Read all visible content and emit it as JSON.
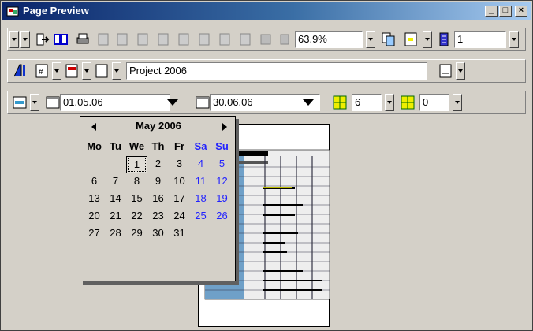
{
  "window": {
    "title": "Page Preview",
    "minimize": "_",
    "maximize": "□",
    "close": "×"
  },
  "toolbar1": {
    "zoom_value": "63.9%",
    "pages_value": "1"
  },
  "toolbar2": {
    "project_name": "Project 2006"
  },
  "toolbar3": {
    "start_date": "01.05.06",
    "end_date": "30.06.06",
    "rows_value": "6",
    "cols_value": "0"
  },
  "calendar": {
    "month_label": "May 2006",
    "weekdays": [
      "Mo",
      "Tu",
      "We",
      "Th",
      "Fr",
      "Sa",
      "Su"
    ],
    "weeks": [
      [
        "",
        "",
        "",
        "1",
        "2",
        "3",
        "4",
        "5"
      ],
      [
        "6",
        "7",
        "8",
        "9",
        "10",
        "11",
        "12"
      ],
      [
        "13",
        "14",
        "15",
        "16",
        "17",
        "18",
        "19"
      ],
      [
        "20",
        "21",
        "22",
        "23",
        "24",
        "25",
        "26"
      ],
      [
        "27",
        "28",
        "29",
        "30",
        "31",
        "",
        ""
      ]
    ],
    "selected_day": "1",
    "weekend_color": "#2222ff"
  }
}
